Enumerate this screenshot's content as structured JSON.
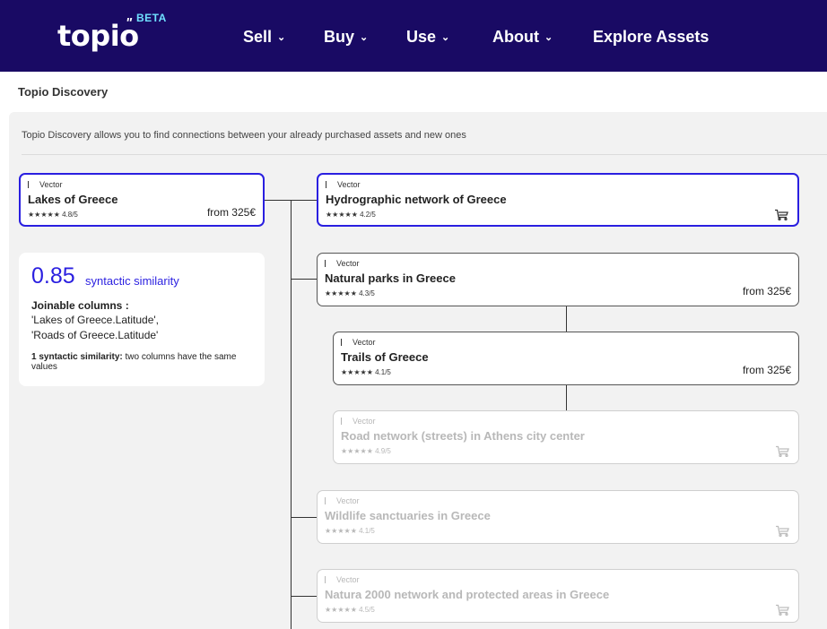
{
  "header": {
    "logo_text": "topio",
    "logo_mark": "\"",
    "beta": "BETA",
    "nav": [
      {
        "label": "Sell",
        "has_menu": true
      },
      {
        "label": "Buy",
        "has_menu": true
      },
      {
        "label": "Use",
        "has_menu": true
      },
      {
        "label": "About",
        "has_menu": true
      },
      {
        "label": "Explore Assets",
        "has_menu": false
      }
    ],
    "chevron": "⌄"
  },
  "page": {
    "title": "Topio Discovery",
    "intro": "Topio Discovery allows you to find connections between your already purchased assets and new ones"
  },
  "source_asset": {
    "type": "Vector",
    "title": "Lakes of Greece",
    "rating": "★★★★★ 4.8/5",
    "price": "from 325€"
  },
  "similarity": {
    "score": "0.85",
    "label": "syntactic similarity",
    "columns_title": "Joinable columns :",
    "columns": [
      "'Lakes of Greece.Latitude',",
      "'Roads of Greece.Latitude'"
    ],
    "note_strong": "1 syntactic similarity:",
    "note_text": " two columns have the same values"
  },
  "related_assets": [
    {
      "type": "Vector",
      "title": "Hydrographic network of Greece",
      "rating": "★★★★★ 4.2/5",
      "price": "",
      "icon": "cart-icon"
    },
    {
      "type": "Vector",
      "title": "Natural parks in Greece",
      "rating": "★★★★★ 4.3/5",
      "price": "from 325€",
      "icon": ""
    },
    {
      "type": "Vector",
      "title": "Trails of Greece",
      "rating": "★★★★★ 4.1/5",
      "price": "from 325€",
      "icon": ""
    },
    {
      "type": "Vector",
      "title": "Road network (streets) in Athens city center",
      "rating": "★★★★★ 4.9/5",
      "price": "",
      "icon": "cart-icon"
    },
    {
      "type": "Vector",
      "title": "Wildlife sanctuaries in Greece",
      "rating": "★★★★★ 4.1/5",
      "price": "",
      "icon": "cart-icon"
    },
    {
      "type": "Vector",
      "title": "Natura 2000 network and protected areas in Greece",
      "rating": "★★★★★ 4.5/5",
      "price": "",
      "icon": "cart-icon"
    }
  ],
  "colors": {
    "nav_bg": "#190a64",
    "accent": "#2a1fe0",
    "beta": "#6fe0ff"
  }
}
